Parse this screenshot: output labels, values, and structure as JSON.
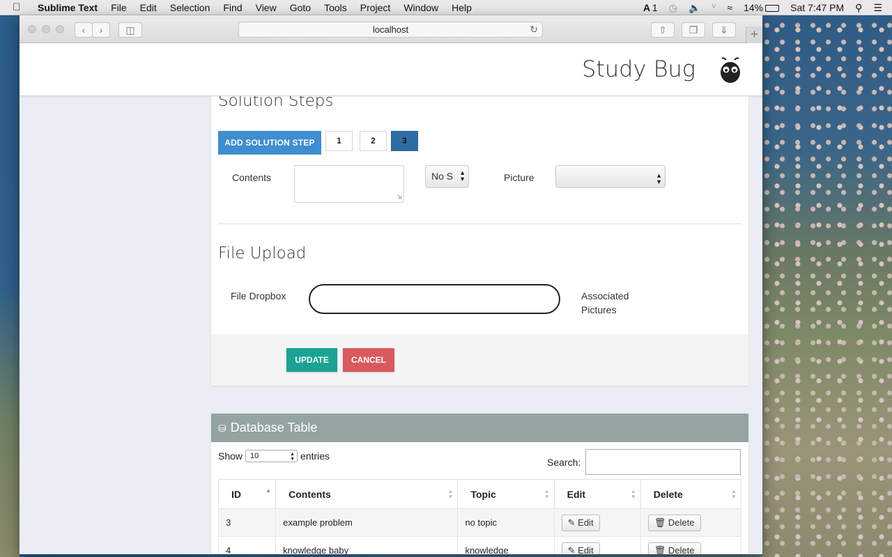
{
  "menubar": {
    "app": "Sublime Text",
    "items": [
      "File",
      "Edit",
      "Selection",
      "Find",
      "View",
      "Goto",
      "Tools",
      "Project",
      "Window",
      "Help"
    ],
    "status": {
      "adobe_count": "1",
      "battery": "14%",
      "clock": "Sat 7:47 PM"
    }
  },
  "browser": {
    "url": "localhost"
  },
  "header": {
    "brand": "Study Bug"
  },
  "solution_steps": {
    "title": "Solution Steps",
    "add_button": "ADD SOLUTION STEP",
    "tabs": [
      "1",
      "2",
      "3"
    ],
    "active_tab": "3",
    "contents_label": "Contents",
    "contents_value": "",
    "step_select_value": "No S",
    "picture_label": "Picture",
    "picture_value": ""
  },
  "file_upload": {
    "title": "File Upload",
    "dropbox_label": "File Dropbox",
    "associated_label_1": "Associated",
    "associated_label_2": "Pictures"
  },
  "actions": {
    "update": "UPDATE",
    "cancel": "CANCEL"
  },
  "database": {
    "title": "Database Table",
    "show_label": "Show",
    "entries_value": "10",
    "entries_label": "entries",
    "search_label": "Search:",
    "search_value": "",
    "columns": [
      "ID",
      "Contents",
      "Topic",
      "Edit",
      "Delete"
    ],
    "rows": [
      {
        "id": "3",
        "contents": "example problem",
        "topic": "no topic",
        "edit": "Edit",
        "delete": "Delete"
      },
      {
        "id": "4",
        "contents": "knowledge baby",
        "topic": "knowledge",
        "edit": "Edit",
        "delete": "Delete"
      }
    ]
  },
  "colors": {
    "primary": "#3e8ed0",
    "active_tab": "#2e6da4",
    "update": "#1aa394",
    "cancel": "#d95a5e",
    "db_header": "#93a4a1"
  }
}
